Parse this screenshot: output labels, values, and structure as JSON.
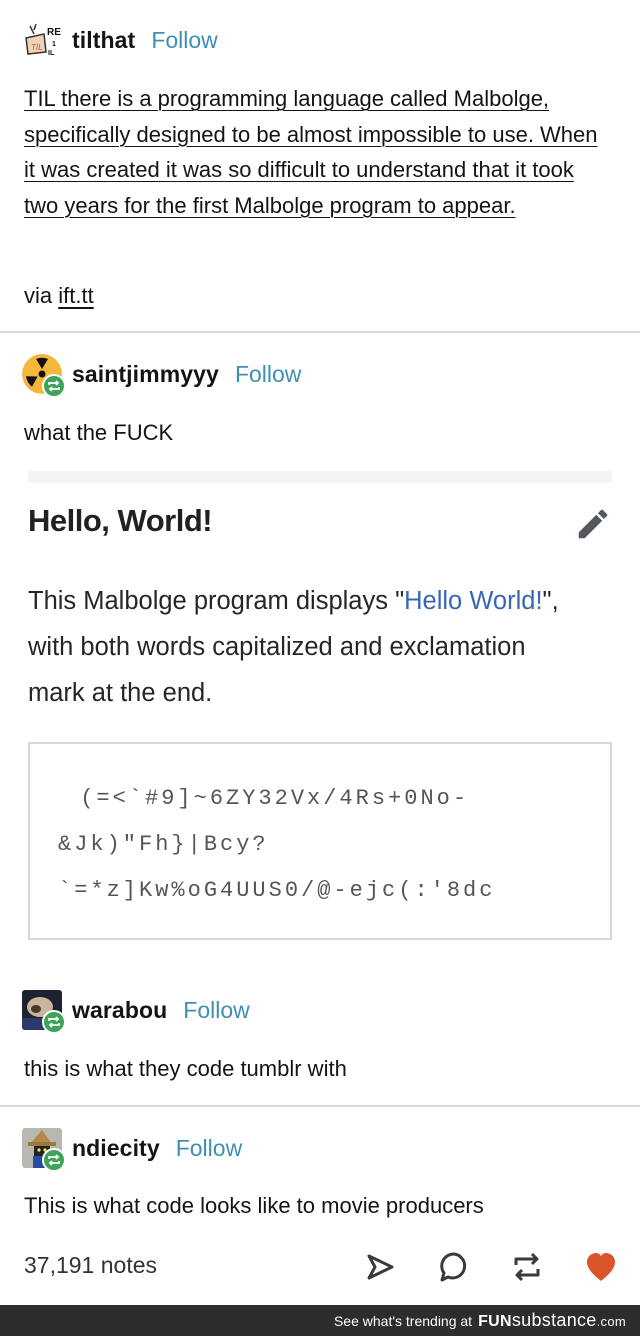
{
  "posts": [
    {
      "username": "tilthat",
      "follow_label": "Follow",
      "avatar_icon": "til-logo-avatar",
      "reblogged": false,
      "text": "TIL there is a programming language called Malbolge, specifically designed to be almost impossible to use. When it was created it was so difficult to understand that it took two years for the first Malbolge program to appear.",
      "via_prefix": "via",
      "via_link": "ift.tt"
    },
    {
      "username": "saintjimmyyy",
      "follow_label": "Follow",
      "avatar_icon": "radiation-avatar",
      "reblogged": true,
      "text": "what the FUCK"
    },
    {
      "username": "warabou",
      "follow_label": "Follow",
      "avatar_icon": "pug-avatar",
      "reblogged": true,
      "text": "this is what they code tumblr with"
    },
    {
      "username": "ndiecity",
      "follow_label": "Follow",
      "avatar_icon": "black-mage-avatar",
      "reblogged": true,
      "text": "This is what code looks like to movie producers"
    }
  ],
  "wiki_screenshot": {
    "title": "Hello, World!",
    "edit_icon": "pencil-icon",
    "desc_before": "This Malbolge program displays \"",
    "desc_link": "Hello World!",
    "desc_after": "\", with both words capitalized and exclamation mark at the end.",
    "code_lines": [
      " (=<`#9]~6ZY32Vx/4Rs+0No-",
      "&Jk)\"Fh}|Bcy?",
      "`=*z]Kw%oG4UUS0/@-ejc(:'8dc"
    ]
  },
  "footer_bar": {
    "notes": "37,191 notes",
    "actions": [
      "share",
      "reply",
      "reblog",
      "like"
    ],
    "like_color": "#d9562b"
  },
  "watermark": {
    "text": "See what's trending at",
    "brand_bold": "FUN",
    "brand_rest": "substance",
    "brand_tld": ".com"
  }
}
